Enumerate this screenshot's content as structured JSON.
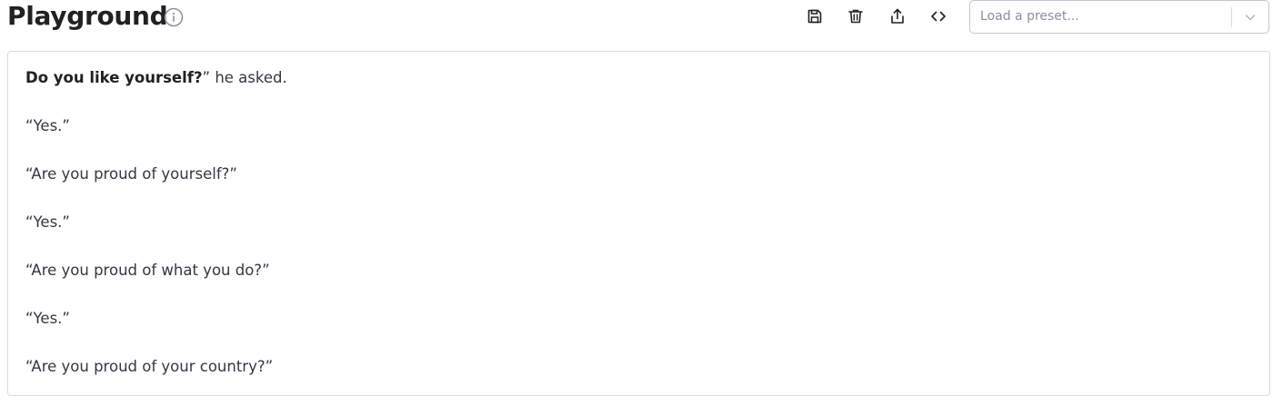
{
  "header": {
    "title": "Playground",
    "info_icon": "info-icon",
    "toolbar": [
      {
        "name": "save-button",
        "icon": "save-icon"
      },
      {
        "name": "delete-button",
        "icon": "trash-icon"
      },
      {
        "name": "share-button",
        "icon": "share-icon"
      },
      {
        "name": "view-code-button",
        "icon": "code-icon"
      }
    ],
    "preset": {
      "placeholder": "Load a preset...",
      "icon": "chevron-down-icon"
    }
  },
  "editor": {
    "first_line_bold": "Do you like yourself?",
    "first_line_rest": "” he asked.",
    "lines": [
      "“Yes.”",
      "“Are you proud of yourself?”",
      "“Yes.”",
      "“Are you proud of what you do?”",
      "“Yes.”",
      "“Are you proud of your country?”"
    ]
  },
  "colors": {
    "text": "#353740",
    "title": "#202123",
    "border": "#d9d9e3",
    "placeholder": "#8e8ea0"
  }
}
